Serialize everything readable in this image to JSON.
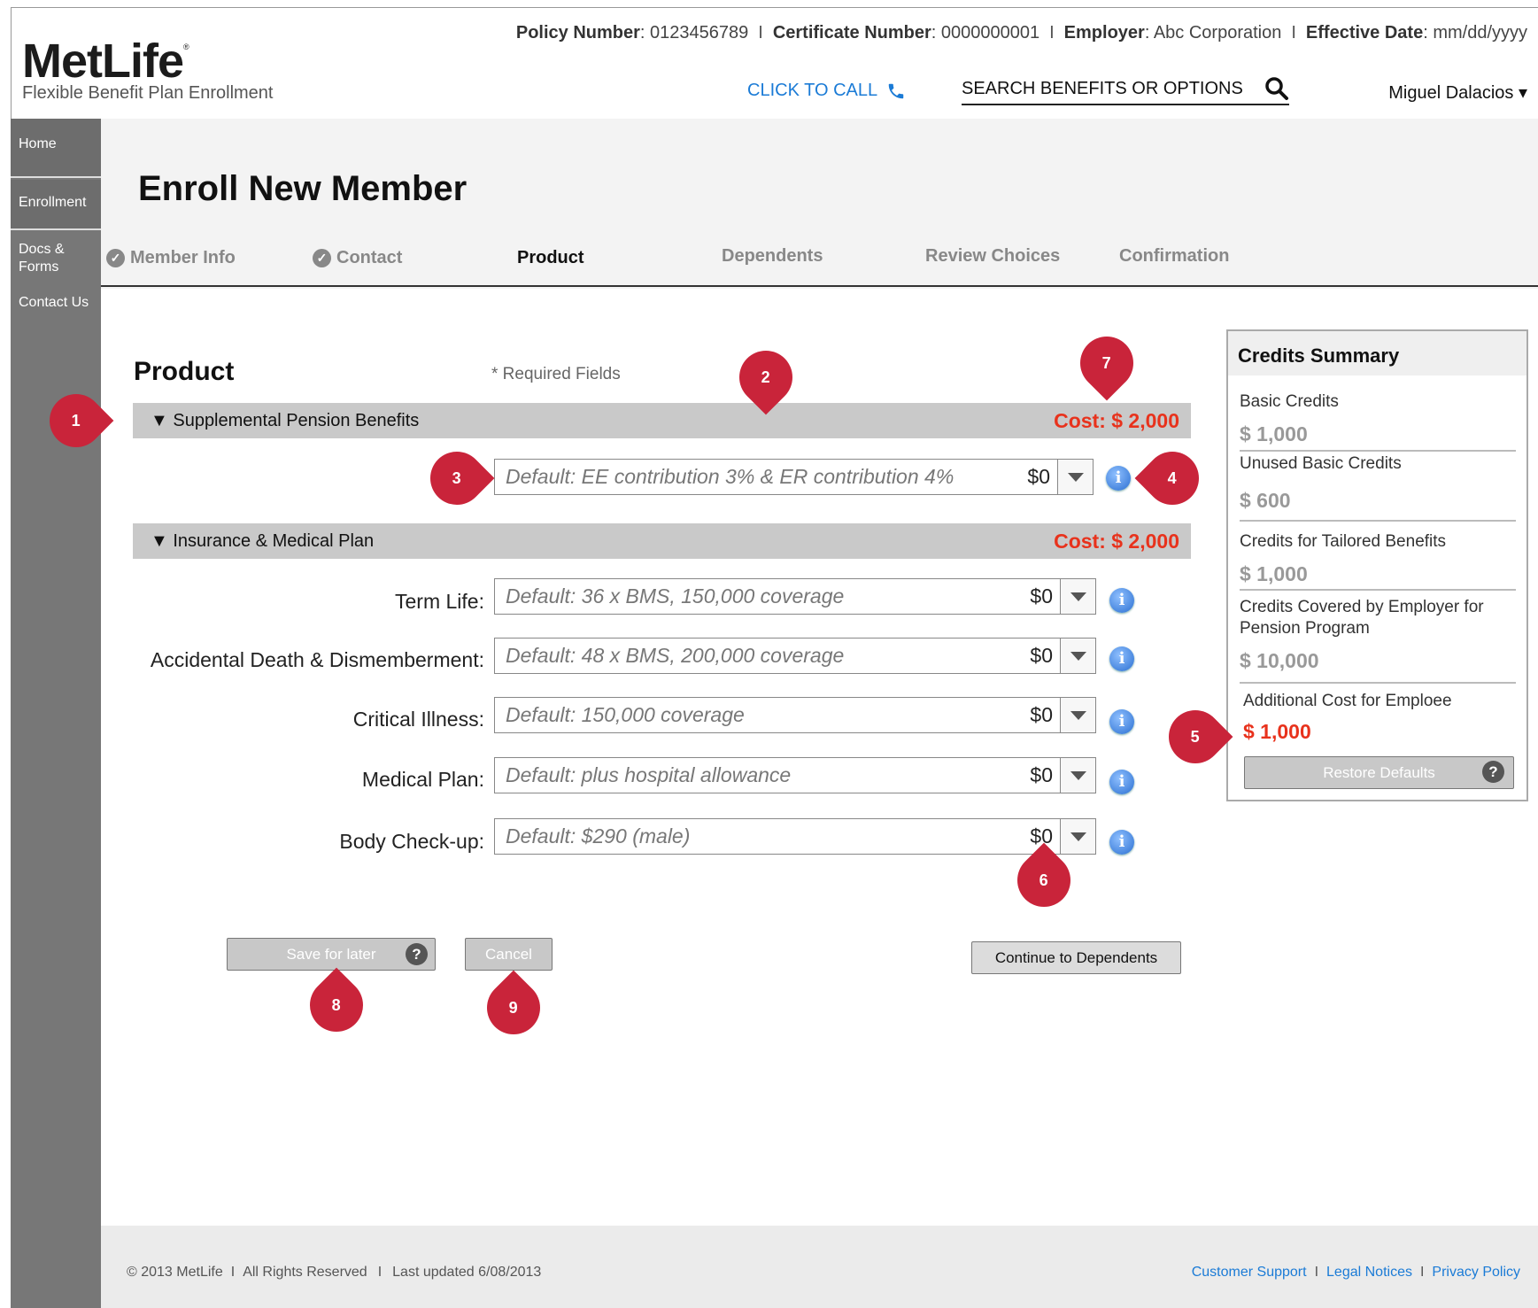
{
  "header": {
    "logo": "MetLife",
    "logo_mark": "®",
    "subtitle": "Flexible Benefit Plan Enrollment",
    "policy_label": "Policy Number",
    "policy_value": ": 0123456789",
    "certificate_label": "Certificate Number",
    "certificate_value": ": 0000000001",
    "employer_label": "Employer",
    "employer_value": ": Abc Corporation",
    "effective_label": "Effective Date",
    "effective_value": ": mm/dd/yyyy",
    "separator": "I",
    "click_to_call": "CLICK TO CALL",
    "search_label": "SEARCH BENEFITS OR OPTIONS",
    "user_name": "Miguel Dalacios ▾"
  },
  "sidebar": {
    "items": [
      {
        "label": "Home"
      },
      {
        "label": "Enrollment"
      },
      {
        "label_line1": "Docs &",
        "label_line2": "Forms"
      },
      {
        "label": "Contact Us"
      }
    ]
  },
  "page": {
    "title": "Enroll New Member",
    "steps": [
      {
        "label": "Member Info",
        "done": true
      },
      {
        "label": "Contact",
        "done": true
      },
      {
        "label": "Product",
        "active": true
      },
      {
        "label": "Dependents"
      },
      {
        "label": "Review Choices"
      },
      {
        "label": "Confirmation"
      }
    ],
    "check_glyph": "✓"
  },
  "product": {
    "title": "Product",
    "required_note": "* Required Fields",
    "groups": [
      {
        "label": "▼ Supplemental Pension Benefits",
        "cost": "Cost: $ 2,000",
        "options": [
          {
            "label": "",
            "value": "Default: EE contribution 3% & ER contribution 4%",
            "price": "$0"
          }
        ]
      },
      {
        "label": "▼ Insurance & Medical Plan",
        "cost": "Cost: $ 2,000",
        "options": [
          {
            "label": "Term Life:",
            "value": "Default: 36 x BMS, 150,000 coverage",
            "price": "$0"
          },
          {
            "label": "Accidental Death & Dismemberment:",
            "value": "Default: 48 x BMS, 200,000 coverage",
            "price": "$0"
          },
          {
            "label": "Critical Illness:",
            "value": "Default: 150,000 coverage",
            "price": "$0"
          },
          {
            "label": "Medical Plan:",
            "value": "Default: plus hospital allowance",
            "price": "$0"
          },
          {
            "label": "Body Check-up:",
            "value": "Default: $290 (male)",
            "price": "$0"
          }
        ]
      }
    ],
    "info_glyph": "i"
  },
  "credits": {
    "title": "Credits Summary",
    "items": [
      {
        "label": "Basic Credits",
        "value": "$ 1,000"
      },
      {
        "label": "Unused Basic Credits",
        "value": "$ 600"
      },
      {
        "label": "Credits for Tailored Benefits",
        "value": "$ 1,000"
      },
      {
        "label": "Credits Covered by Employer for Pension Program",
        "value": "$ 10,000"
      },
      {
        "label": "Additional Cost for Emploee",
        "value": "$ 1,000"
      }
    ],
    "restore_button": "Restore Defaults"
  },
  "actions": {
    "save_later": "Save for later",
    "cancel": "Cancel",
    "continue": "Continue to Dependents",
    "help_glyph": "?"
  },
  "markers": [
    "1",
    "2",
    "3",
    "4",
    "5",
    "6",
    "7",
    "8",
    "9"
  ],
  "footer": {
    "copyright": "© 2013 MetLife",
    "rights": "All Rights Reserved",
    "updated": "Last updated 6/08/2013",
    "separator": "I",
    "links": [
      "Customer Support",
      "Legal Notices",
      "Privacy Policy"
    ]
  },
  "colors": {
    "accent_red": "#e8321c",
    "marker_red": "#c9243a",
    "link_blue": "#1b7bd6",
    "sidebar_gray": "#777777"
  }
}
